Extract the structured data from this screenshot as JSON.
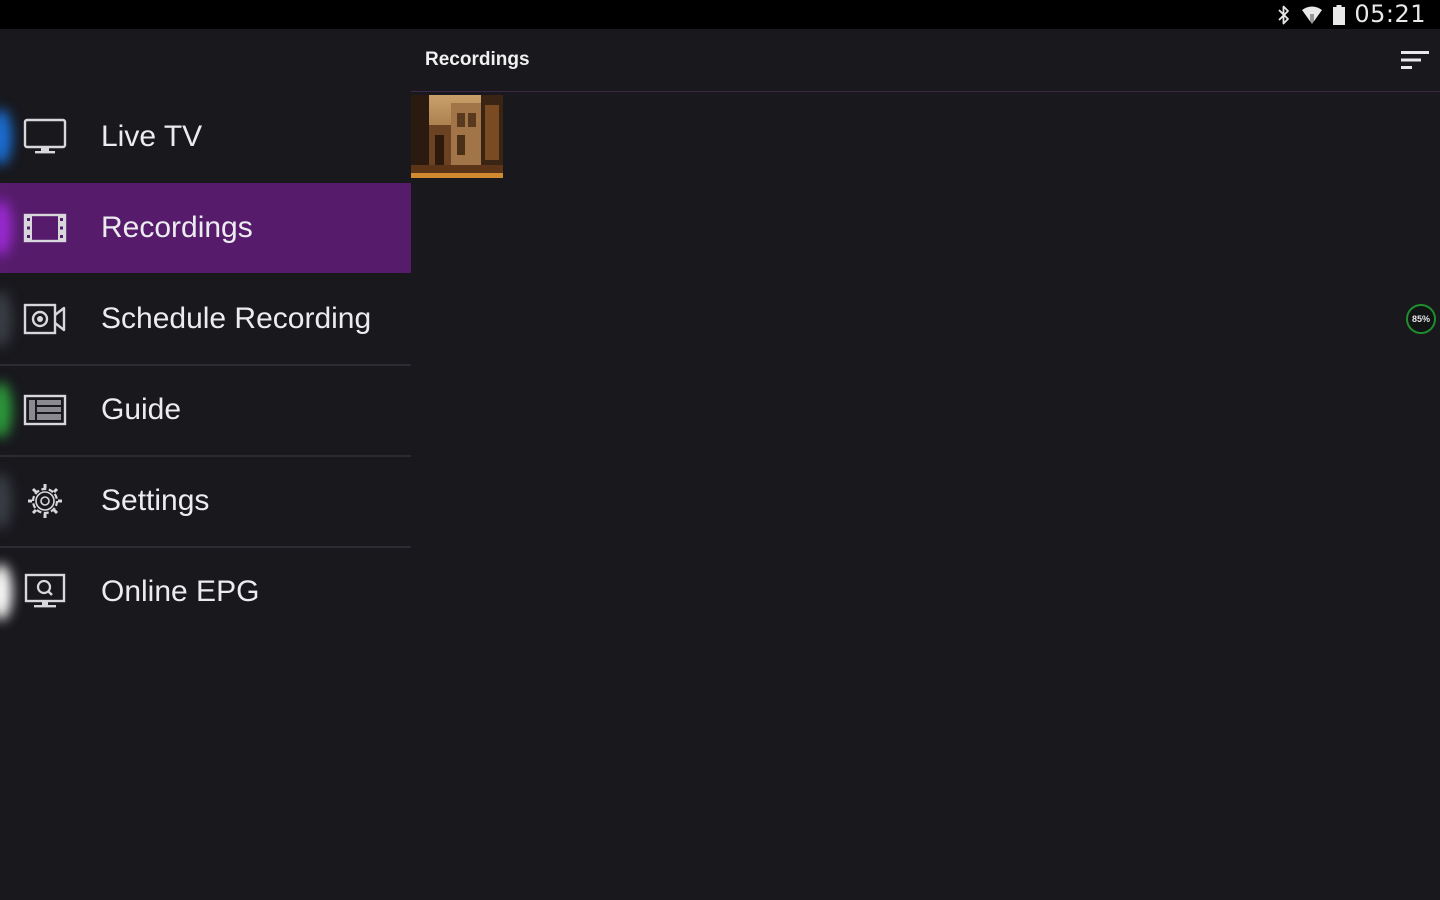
{
  "status_bar": {
    "time": "05:21",
    "icons": [
      "bluetooth-icon",
      "wifi-icon",
      "battery-icon"
    ]
  },
  "sidebar": {
    "items": [
      {
        "label": "Live TV",
        "icon": "tv-icon",
        "accent": "#1a6fd6",
        "active": false
      },
      {
        "label": "Recordings",
        "icon": "film-icon",
        "accent": "#9a2ad0",
        "active": true
      },
      {
        "label": "Schedule Recording",
        "icon": "record-camera-icon",
        "accent": "#3a3d45",
        "active": false
      },
      {
        "label": "Guide",
        "icon": "guide-icon",
        "accent": "#2c9a3a",
        "active": false
      },
      {
        "label": "Settings",
        "icon": "gear-icon",
        "accent": "#3a3d45",
        "active": false
      },
      {
        "label": "Online EPG",
        "icon": "online-epg-icon",
        "accent": "#ffffff",
        "active": false
      }
    ]
  },
  "header": {
    "title": "Recordings",
    "sort_icon": "sort-icon"
  },
  "recordings": {
    "items": [
      {
        "thumbnail_icon": "recording-thumbnail"
      }
    ]
  },
  "storage": {
    "label": "85%"
  },
  "colors": {
    "background": "#18181d",
    "active_item": "#561c6b",
    "divider": "#2b2b31",
    "status_bar": "#000000",
    "storage_ring": "#1f8f2e"
  }
}
